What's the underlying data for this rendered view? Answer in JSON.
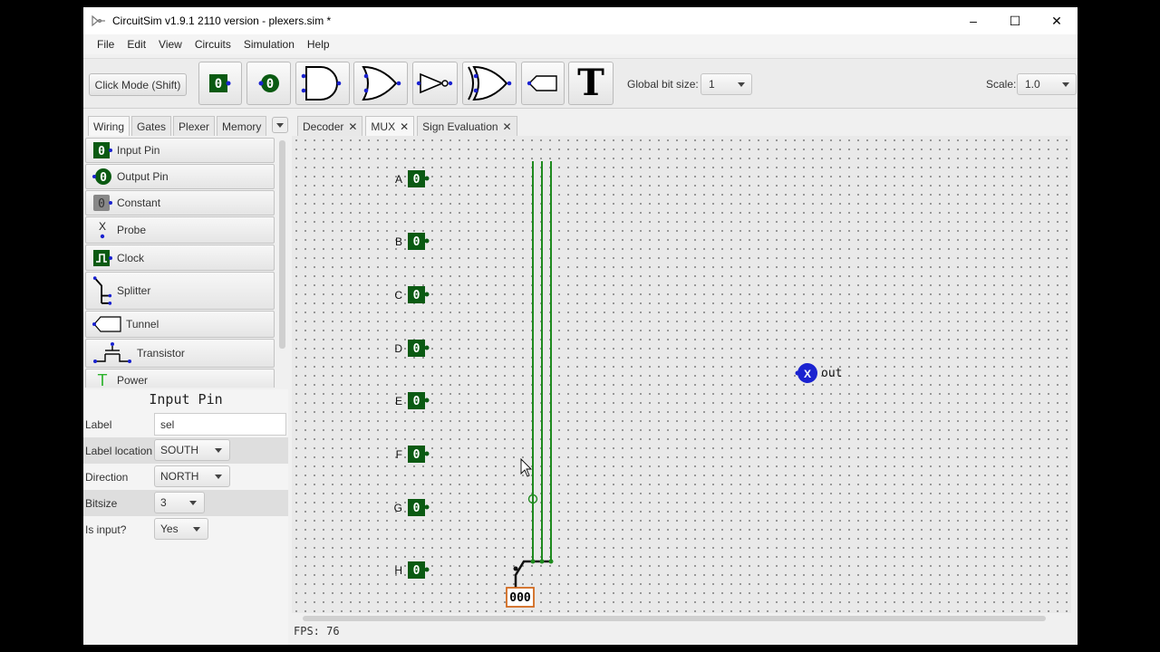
{
  "window": {
    "title": "CircuitSim v1.9.1 2110 version - plexers.sim *",
    "controls": {
      "minimize": "–",
      "maximize": "☐",
      "close": "✕"
    }
  },
  "menu": [
    "File",
    "Edit",
    "View",
    "Circuits",
    "Simulation",
    "Help"
  ],
  "toolbar": {
    "click_mode": "Click Mode (Shift)",
    "input_pin_glyph": "0",
    "output_pin_glyph": "0",
    "text_tool_glyph": "T",
    "global_bit_size_label": "Global bit size:",
    "global_bit_size_value": "1",
    "scale_label": "Scale:",
    "scale_value": "1.0"
  },
  "library_tabs": [
    "Wiring",
    "Gates",
    "Plexer",
    "Memory"
  ],
  "components": [
    {
      "label": "Input Pin",
      "icon": "input-pin-icon"
    },
    {
      "label": "Output Pin",
      "icon": "output-pin-icon"
    },
    {
      "label": "Constant",
      "icon": "constant-icon"
    },
    {
      "label": "Probe",
      "icon": "probe-icon"
    },
    {
      "label": "Clock",
      "icon": "clock-icon"
    },
    {
      "label": "Splitter",
      "icon": "splitter-icon"
    },
    {
      "label": "Tunnel",
      "icon": "tunnel-icon"
    },
    {
      "label": "Transistor",
      "icon": "transistor-icon"
    },
    {
      "label": "Power",
      "icon": "power-icon"
    }
  ],
  "icon_glyphs": {
    "input_pin": "0",
    "output_pin": "0",
    "constant": "0",
    "probe": "X",
    "power": "T"
  },
  "properties": {
    "title": "Input Pin",
    "rows": [
      {
        "label": "Label",
        "value": "sel",
        "kind": "text"
      },
      {
        "label": "Label location",
        "value": "SOUTH",
        "kind": "combo"
      },
      {
        "label": "Direction",
        "value": "NORTH",
        "kind": "combo"
      },
      {
        "label": "Bitsize",
        "value": "3",
        "kind": "combo"
      },
      {
        "label": "Is input?",
        "value": "Yes",
        "kind": "combo"
      }
    ]
  },
  "circuit_tabs": [
    {
      "label": "Decoder",
      "close": "✕"
    },
    {
      "label": "MUX",
      "close": "✕"
    },
    {
      "label": "Sign Evaluation",
      "close": "✕"
    }
  ],
  "canvas": {
    "pins": [
      {
        "label": "A",
        "value": "0"
      },
      {
        "label": "B",
        "value": "0"
      },
      {
        "label": "C",
        "value": "0"
      },
      {
        "label": "D",
        "value": "0"
      },
      {
        "label": "E",
        "value": "0"
      },
      {
        "label": "F",
        "value": "0"
      },
      {
        "label": "G",
        "value": "0"
      },
      {
        "label": "H",
        "value": "0"
      }
    ],
    "select_pin_value": "000",
    "output_probe_glyph": "X",
    "output_label": "out"
  },
  "status": {
    "fps": "FPS: 76"
  },
  "colors": {
    "pin_green": "#0a5a12",
    "wire_green": "#1e8a1e",
    "output_blue": "#1a22d0",
    "select_border": "#d2691e"
  }
}
